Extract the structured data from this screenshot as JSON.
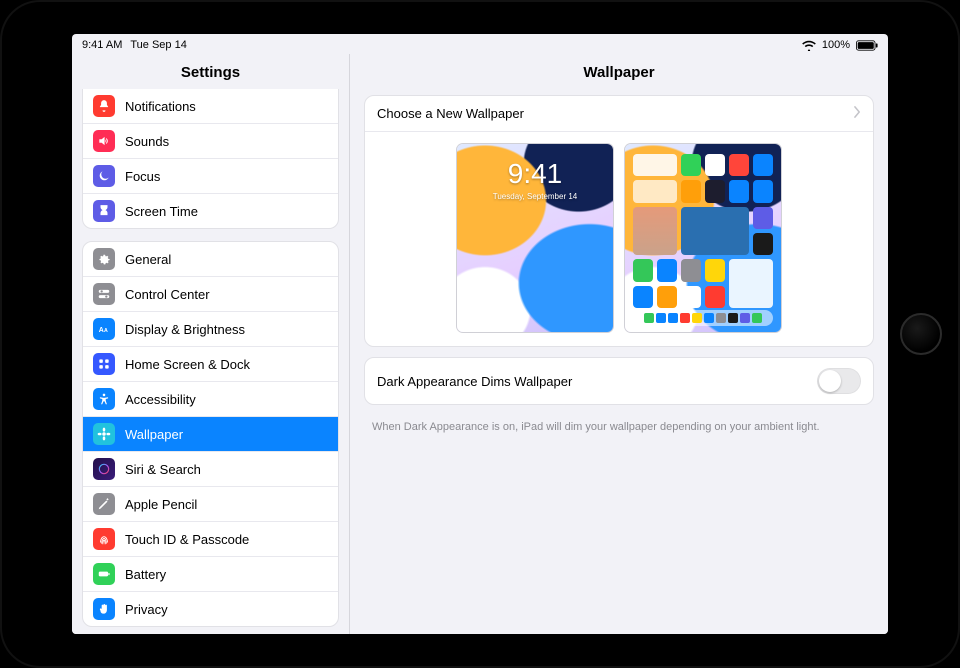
{
  "statusbar": {
    "time": "9:41 AM",
    "date": "Tue Sep 14",
    "battery": "100%"
  },
  "sidebar": {
    "title": "Settings",
    "group1": [
      {
        "label": "Notifications",
        "icon": "bell",
        "color": "#ff3b30"
      },
      {
        "label": "Sounds",
        "icon": "speaker",
        "color": "#ff2d55"
      },
      {
        "label": "Focus",
        "icon": "moon",
        "color": "#5e5ce6"
      },
      {
        "label": "Screen Time",
        "icon": "hourglass",
        "color": "#5e5ce6"
      }
    ],
    "group2": [
      {
        "label": "General",
        "icon": "gear",
        "color": "#8e8e93"
      },
      {
        "label": "Control Center",
        "icon": "switches",
        "color": "#8e8e93"
      },
      {
        "label": "Display & Brightness",
        "icon": "aa",
        "color": "#0a84ff"
      },
      {
        "label": "Home Screen & Dock",
        "icon": "grid",
        "color": "#3558ff"
      },
      {
        "label": "Accessibility",
        "icon": "person",
        "color": "#0a84ff"
      },
      {
        "label": "Wallpaper",
        "icon": "flower",
        "color": "#21c2de",
        "selected": true
      },
      {
        "label": "Siri & Search",
        "icon": "siri",
        "color": "#1b1b2e"
      },
      {
        "label": "Apple Pencil",
        "icon": "pencil",
        "color": "#8e8e93"
      },
      {
        "label": "Touch ID & Passcode",
        "icon": "fingerprint",
        "color": "#ff3b30"
      },
      {
        "label": "Battery",
        "icon": "battery",
        "color": "#30d158"
      },
      {
        "label": "Privacy",
        "icon": "hand",
        "color": "#0a84ff"
      }
    ]
  },
  "main": {
    "title": "Wallpaper",
    "choose_label": "Choose a New Wallpaper",
    "lock_preview": {
      "time": "9:41",
      "date": "Tuesday, September 14"
    },
    "dark_row_label": "Dark Appearance Dims Wallpaper",
    "dark_toggle_on": false,
    "footer_note": "When Dark Appearance is on, iPad will dim your wallpaper depending on your ambient light."
  }
}
